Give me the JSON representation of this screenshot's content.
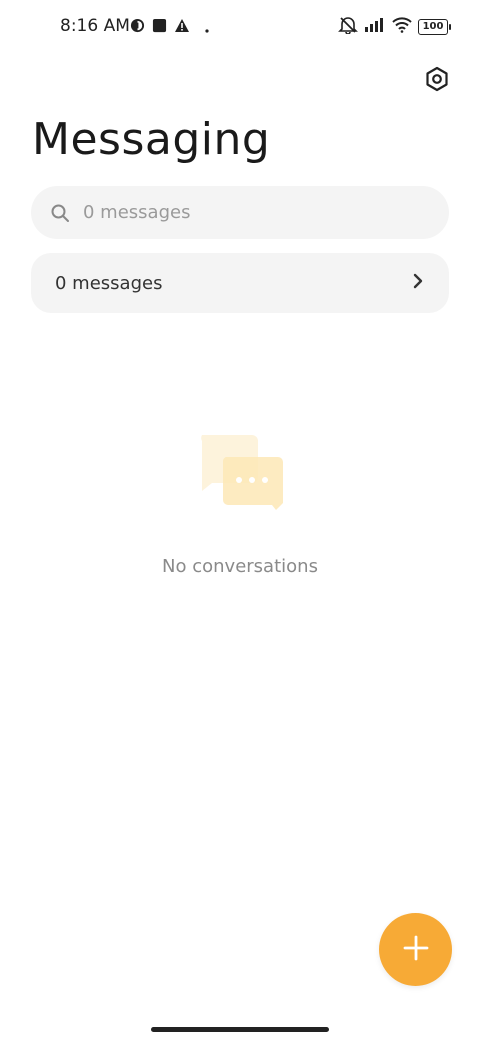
{
  "status_bar": {
    "time": "8:16 AM",
    "battery": "100",
    "icons": [
      "circle-half-icon",
      "square-icon",
      "warning-icon",
      "dot-icon",
      "mute-icon",
      "signal-icon",
      "wifi-icon",
      "battery-icon"
    ]
  },
  "header": {
    "title": "Messaging",
    "settings_icon": "hexagon-gear-icon"
  },
  "search": {
    "placeholder": "0 messages",
    "value": ""
  },
  "messages_row": {
    "label": "0 messages",
    "chevron_icon": "chevron-right-icon"
  },
  "empty_state": {
    "illustration_icon": "chat-bubbles-icon",
    "text": "No conversations"
  },
  "fab": {
    "icon": "plus-icon"
  },
  "colors": {
    "accent": "#f7aa36",
    "illustration_light": "#fdf3dc",
    "illustration_mid": "#fde7b6",
    "surface": "#f4f4f4",
    "text_primary": "#1a1a1a",
    "text_secondary": "#8a8a8a"
  }
}
